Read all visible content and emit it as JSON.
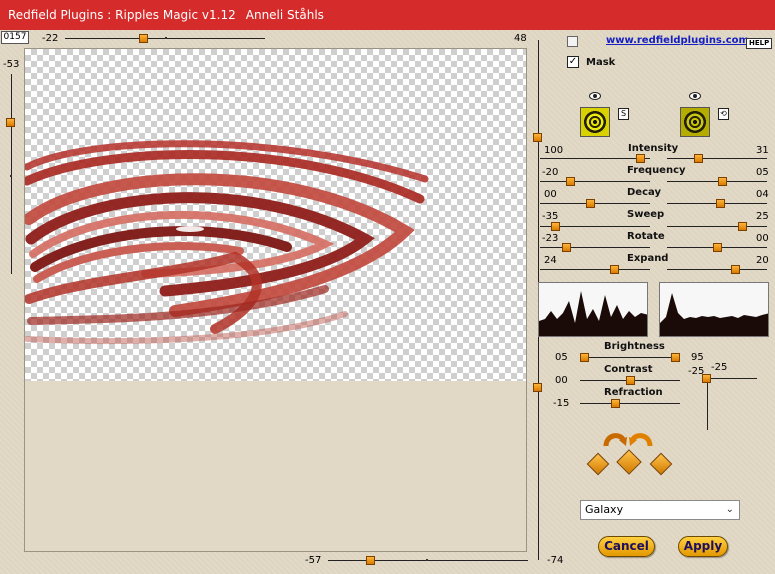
{
  "window": {
    "title_plugin": "Redfield Plugins : Ripples Magic v1.12",
    "title_author": "Anneli Ståhls"
  },
  "preview": {
    "counter": "0157",
    "top_slider": {
      "min_label": "-22",
      "max_label": "48"
    },
    "left_slider": {
      "label": "-53"
    },
    "bottom_slider": {
      "min_label": "-57",
      "max_label": "-74"
    }
  },
  "header": {
    "link": "www.redfieldplugins.com",
    "help": "HELP",
    "mask_label": "Mask",
    "mask_checked": "✓"
  },
  "texture_buttons": {
    "left_btn": "S",
    "right_btn": "⟲"
  },
  "params": [
    {
      "name": "Intensity",
      "left": "100",
      "right": "31"
    },
    {
      "name": "Frequency",
      "left": "-20",
      "right": "05"
    },
    {
      "name": "Decay",
      "left": "00",
      "right": "04"
    },
    {
      "name": "Sweep",
      "left": "-35",
      "right": "25"
    },
    {
      "name": "Rotate",
      "left": "-23",
      "right": "00"
    },
    {
      "name": "Expand",
      "left": "24",
      "right": "20"
    }
  ],
  "light": {
    "brightness": {
      "name": "Brightness",
      "left": "05",
      "right": "95"
    },
    "contrast": {
      "name": "Contrast",
      "left": "00"
    },
    "refraction": {
      "name": "Refraction",
      "left": "-15"
    },
    "side_top": "-25",
    "side_mid": "-25"
  },
  "preset": {
    "selected": "Galaxy"
  },
  "actions": {
    "cancel": "Cancel",
    "apply": "Apply"
  },
  "colors": {
    "title_bg": "#d62b2b",
    "accent": "#f0a000",
    "ripple": "#b5302a"
  }
}
